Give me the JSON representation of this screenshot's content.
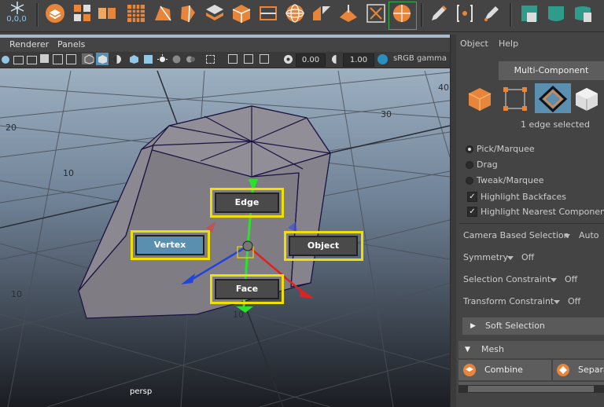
{
  "shelf": {
    "coord_label": "0,0,0",
    "icons": [
      "snowflake-icon",
      "layer-icon",
      "component-grid-icon",
      "cube-pair-icon",
      "grid-icon",
      "polygon-icon",
      "cylinder-icon",
      "multi-cube-icon",
      "cube-icon",
      "edge-loop-icon",
      "sphere-wire-icon",
      "bevel-icon",
      "frame-icon",
      "combine-icon",
      "pencil-icon",
      "bracket-icon",
      "marker-icon",
      "plane-icon",
      "shelf-cube-icon",
      "cone-icon"
    ]
  },
  "viewport": {
    "menus": [
      "Renderer",
      "Panels"
    ],
    "exposure_value": "0.00",
    "gamma_value": "1.00",
    "color_space": "sRGB gamma",
    "camera": "persp",
    "grid_labels": [
      "20",
      "10",
      "10",
      "30",
      "40",
      "10"
    ]
  },
  "marking_menu": {
    "edge": "Edge",
    "vertex": "Vertex",
    "object": "Object",
    "face": "Face"
  },
  "panel": {
    "menus": [
      "Object",
      "Help"
    ],
    "tab": "Multi-Component",
    "selection_status": "1 edge selected",
    "tool_options": [
      {
        "label": "Pick/Marquee",
        "selected": true
      },
      {
        "label": "Drag",
        "selected": false
      },
      {
        "label": "Tweak/Marquee",
        "selected": false
      }
    ],
    "checkboxes": [
      {
        "label": "Highlight Backfaces",
        "checked": true
      },
      {
        "label": "Highlight Nearest Component",
        "checked": true
      }
    ],
    "camera_based_selection": {
      "label": "Camera Based Selection",
      "value": "Auto"
    },
    "symmetry": {
      "label": "Symmetry",
      "value": "Off"
    },
    "selection_constraint": {
      "label": "Selection Constraint",
      "value": "Off"
    },
    "transform_constraint": {
      "label": "Transform Constraint",
      "value": "Off"
    },
    "soft_selection": "Soft Selection",
    "mesh_section": "Mesh",
    "combine": "Combine",
    "separate": "Separa"
  },
  "colors": {
    "accent_highlight": "#f0e000",
    "active_mode": "#5b8fb0",
    "mesh_face": "#8a8790",
    "mesh_edge": "#1a1240"
  }
}
